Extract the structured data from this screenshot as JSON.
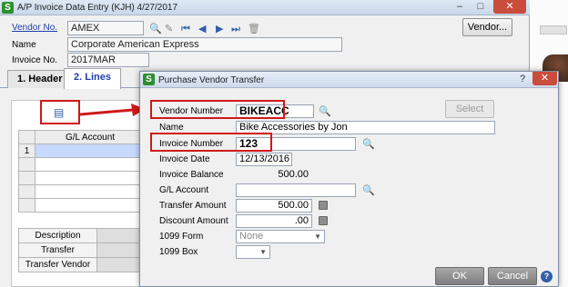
{
  "back_window": {
    "title": "A/P Invoice Data Entry (KJH) 4/27/2017",
    "controls": {
      "minimize": "–",
      "maximize": "□",
      "close": "✕"
    },
    "vendor_no": {
      "label": "Vendor No.",
      "value": "AMEX"
    },
    "name": {
      "label": "Name",
      "value": "Corporate American Express"
    },
    "invoice_no": {
      "label": "Invoice No.",
      "value": "2017MAR"
    },
    "vendor_button": "Vendor...",
    "tabs": [
      {
        "label": "1. Header"
      },
      {
        "label": "2. Lines"
      }
    ],
    "grid": {
      "column": "G/L Account",
      "row_number": "1"
    },
    "totals": {
      "rows": [
        {
          "label": "Description"
        },
        {
          "label": "Transfer"
        },
        {
          "label": "Transfer Vendor"
        }
      ]
    }
  },
  "dialog": {
    "title": "Purchase Vendor Transfer",
    "controls": {
      "help": "?",
      "close": "✕"
    },
    "vendor_number": {
      "label": "Vendor Number",
      "value": "BIKEACC"
    },
    "select_button": "Select",
    "name": {
      "label": "Name",
      "value": "Bike Accessories by Jon"
    },
    "invoice_number": {
      "label": "Invoice Number",
      "value": "123"
    },
    "invoice_date": {
      "label": "Invoice Date",
      "value": "12/13/2016"
    },
    "invoice_balance": {
      "label": "Invoice Balance",
      "value": "500.00"
    },
    "gl_account": {
      "label": "G/L Account",
      "value": ""
    },
    "transfer_amount": {
      "label": "Transfer Amount",
      "value": "500.00"
    },
    "discount_amount": {
      "label": "Discount Amount",
      "value": ".00"
    },
    "form_1099": {
      "label": "1099 Form",
      "value": "None"
    },
    "box_1099": {
      "label": "1099 Box",
      "value": ""
    },
    "ok_button": "OK",
    "cancel_button": "Cancel",
    "help_icon": "?"
  },
  "icons": {
    "app": "S",
    "search": "🔍",
    "first": "⏮",
    "prev": "◀",
    "next": "▶",
    "last": "⏭",
    "delete": "🗑",
    "memo": "▤"
  },
  "colors": {
    "annotation_red": "#d01818",
    "link_blue": "#1f3fa8",
    "app_green": "#2f8f2f"
  }
}
